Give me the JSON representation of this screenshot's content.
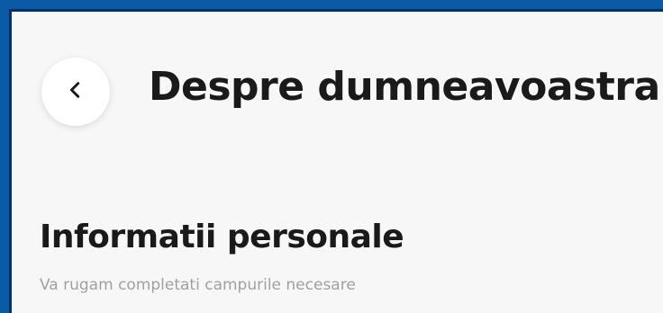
{
  "colors": {
    "frame": "#0a5aa6",
    "frame_dark": "#0a2f63",
    "background": "#f7f7f7",
    "title": "#1a1a1a",
    "subtitle": "#a0a0a0"
  },
  "header": {
    "back_icon": "chevron-left-icon",
    "title": "Despre dumneavoastra"
  },
  "section": {
    "title": "Informatii personale",
    "subtitle": "Va rugam completati campurile necesare"
  }
}
